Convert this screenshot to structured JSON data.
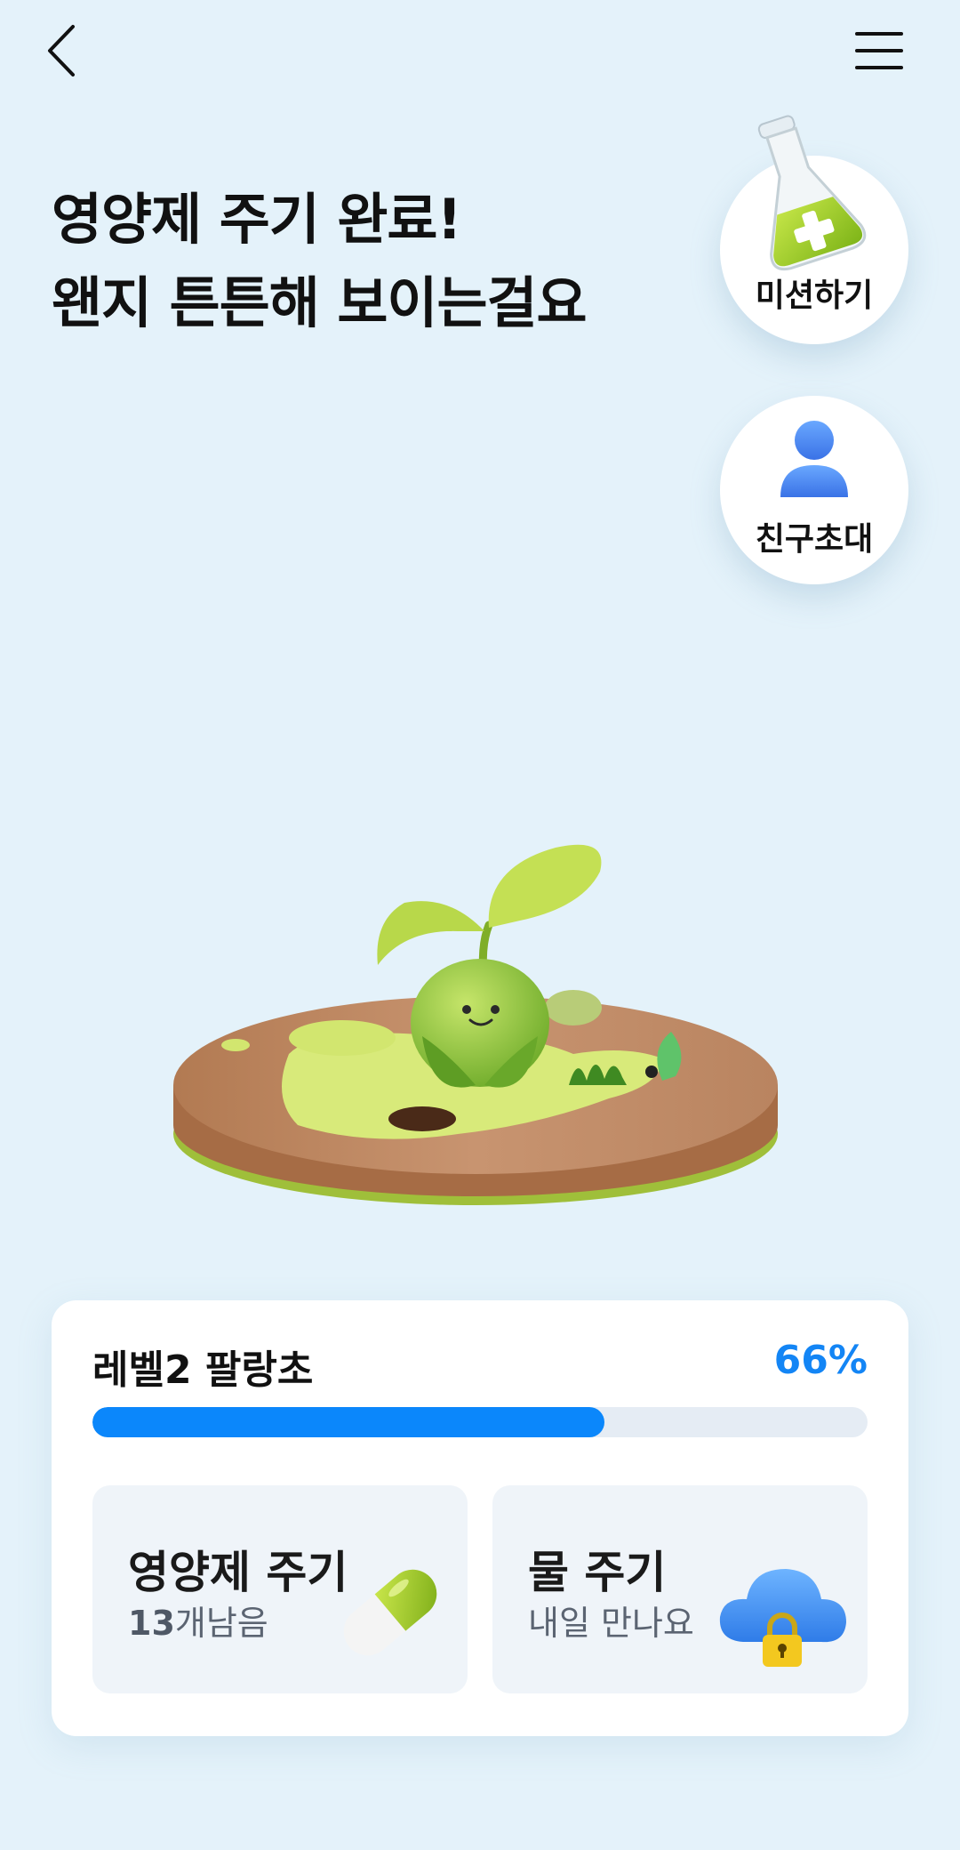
{
  "header": {
    "back_icon": "chevron-left-icon",
    "menu_icon": "hamburger-menu-icon"
  },
  "headline": {
    "line1": "영양제 주기 완료!",
    "line2": "왠지 튼튼해 보이는걸요"
  },
  "side_buttons": {
    "mission": {
      "label": "미션하기",
      "icon": "flask-icon"
    },
    "invite": {
      "label": "친구초대",
      "icon": "person-icon"
    }
  },
  "level": {
    "label": "레벨2 팔랑초",
    "percent_text": "66%",
    "progress": 0.66
  },
  "actions": {
    "nutrient": {
      "title": "영양제 주기",
      "count": "13",
      "remaining_suffix": "개남음",
      "icon": "pill-capsule-icon"
    },
    "water": {
      "title": "물 주기",
      "subtitle": "내일 만나요",
      "icon": "locked-cloud-icon"
    }
  },
  "colors": {
    "background": "#e4f2fa",
    "accent": "#0b87fb",
    "percent_text": "#1385f5",
    "tile_background": "#eff4f9"
  }
}
